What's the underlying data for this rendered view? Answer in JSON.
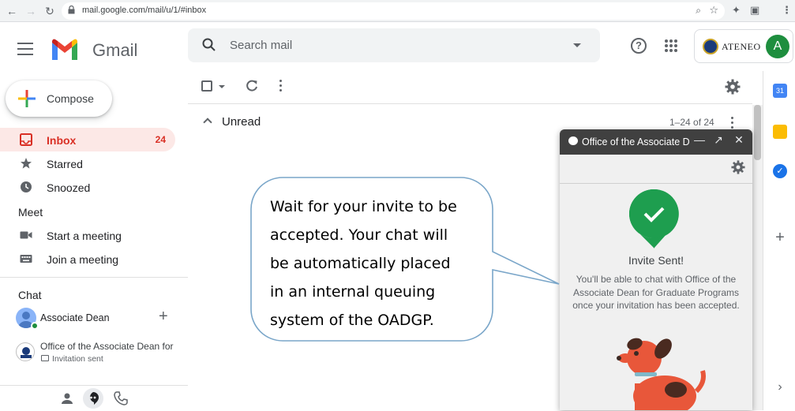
{
  "browser": {
    "url": "mail.google.com/mail/u/1/#inbox"
  },
  "header": {
    "brand": "Gmail",
    "search_placeholder": "Search mail",
    "org_name": "ATENEO",
    "avatar_letter": "A"
  },
  "sidebar": {
    "compose_label": "Compose",
    "items": [
      {
        "label": "Inbox",
        "count": "24",
        "icon": "inbox-icon",
        "active": true
      },
      {
        "label": "Starred",
        "count": "",
        "icon": "star-icon"
      },
      {
        "label": "Snoozed",
        "count": "",
        "icon": "clock-icon"
      }
    ],
    "meet": {
      "title": "Meet",
      "items": [
        {
          "label": "Start a meeting",
          "icon": "video-camera-icon"
        },
        {
          "label": "Join a meeting",
          "icon": "keyboard-icon"
        }
      ]
    },
    "chat": {
      "title": "Chat",
      "users": [
        {
          "name": "Associate Dean",
          "presence_color": "#1e8e3e"
        },
        {
          "name": "Office of the Associate Dean for",
          "status": "Invitation sent"
        }
      ]
    }
  },
  "toolbar": {
    "section_label": "Unread",
    "pagination": "1–24 of 24"
  },
  "chat_popup": {
    "title": "Office of the Associate D",
    "invite_title": "Invite Sent!",
    "invite_message": "You'll be able to chat with Office of the Associate Dean for Graduate Programs once your invitation has been accepted."
  },
  "callout": {
    "lines": [
      "Wait for your invite to be",
      "accepted. Your chat will",
      "be automatically placed",
      "in an internal queuing",
      "system of the OADGP."
    ]
  },
  "colors": {
    "inbox_active_bg": "#fce8e6",
    "inbox_active_text": "#d93025",
    "invite_badge": "#1e9e4f",
    "popup_header": "#404040",
    "callout_border": "#7aa6c9"
  }
}
